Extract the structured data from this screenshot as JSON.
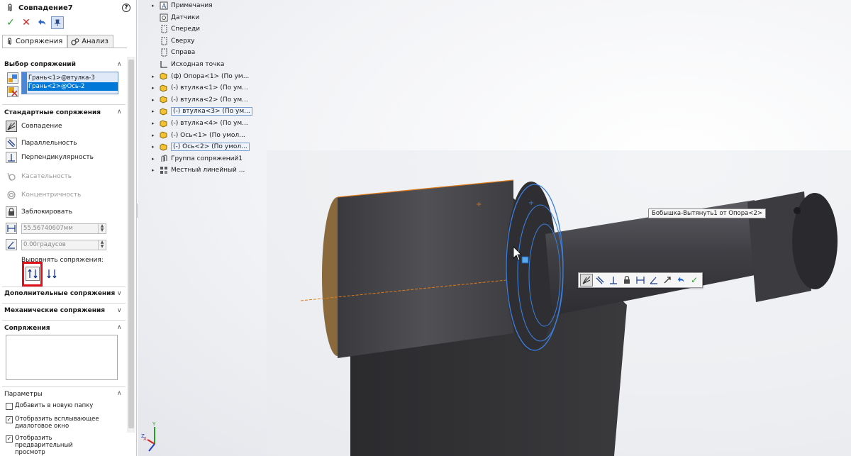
{
  "property_manager": {
    "title": "Совпадение7",
    "tabs": [
      {
        "label": "Сопряжения",
        "active": true
      },
      {
        "label": "Анализ",
        "active": false
      }
    ],
    "mate_selections": {
      "header": "Выбор сопряжений",
      "items": [
        "Грань<1>@втулка-3",
        "Грань<2>@Ось-2"
      ]
    },
    "standard_mates": {
      "header": "Стандартные сопряжения",
      "items": [
        {
          "label": "Совпадение",
          "state": "selected"
        },
        {
          "label": "Параллельность",
          "state": "enabled"
        },
        {
          "label": "Перпендикулярность",
          "state": "enabled"
        },
        {
          "label": "Касательность",
          "state": "disabled"
        },
        {
          "label": "Концентричность",
          "state": "disabled"
        },
        {
          "label": "Заблокировать",
          "state": "enabled"
        }
      ],
      "distance_value": "55.56740607мм",
      "angle_value": "0.00градусов",
      "align_label": "Выровнять сопряжения:"
    },
    "advanced_mates_header": "Дополнительные сопряжения",
    "mechanical_mates_header": "Механические сопряжения",
    "mates_header": "Сопряжения",
    "options": {
      "header": "Параметры",
      "items": [
        {
          "label": "Добавить в новую папку",
          "checked": false
        },
        {
          "label": "Отобразить всплывающее диалоговое окно",
          "checked": true
        },
        {
          "label": "Отобразить предварительный просмотр",
          "checked": true
        }
      ]
    }
  },
  "feature_tree": [
    {
      "label": "Примечания",
      "expandable": true,
      "icon": "annotations-icon",
      "highlight": false
    },
    {
      "label": "Датчики",
      "expandable": false,
      "icon": "sensors-icon",
      "highlight": false
    },
    {
      "label": "Спереди",
      "expandable": false,
      "icon": "plane-icon",
      "highlight": false
    },
    {
      "label": "Сверху",
      "expandable": false,
      "icon": "plane-icon",
      "highlight": false
    },
    {
      "label": "Справа",
      "expandable": false,
      "icon": "plane-icon",
      "highlight": false
    },
    {
      "label": "Исходная точка",
      "expandable": false,
      "icon": "origin-icon",
      "highlight": false
    },
    {
      "label": "(ф) Опора<1> (По ум...",
      "expandable": true,
      "icon": "part-icon",
      "highlight": false
    },
    {
      "label": "(-) втулка<1> (По ум...",
      "expandable": true,
      "icon": "part-icon",
      "highlight": false
    },
    {
      "label": "(-) втулка<2> (По ум...",
      "expandable": true,
      "icon": "part-icon",
      "highlight": false
    },
    {
      "label": "(-) втулка<3> (По ум...",
      "expandable": true,
      "icon": "part-icon",
      "highlight": true
    },
    {
      "label": "(-) втулка<4> (По ум...",
      "expandable": true,
      "icon": "part-icon",
      "highlight": false
    },
    {
      "label": "(-) Ось<1> (По умол...",
      "expandable": true,
      "icon": "part-icon",
      "highlight": false
    },
    {
      "label": "(-) Ось<2> (По умол...",
      "expandable": true,
      "icon": "part-icon",
      "highlight": true
    },
    {
      "label": "Группа сопряжений1",
      "expandable": true,
      "icon": "mates-group-icon",
      "highlight": false
    },
    {
      "label": "Местный линейный ...",
      "expandable": true,
      "icon": "pattern-icon",
      "highlight": false
    }
  ],
  "tooltip": "Бобышка-Вытянуть1 от Опора<2>",
  "triad": {
    "x": "X",
    "y": "Y",
    "z": "Z"
  },
  "colors": {
    "selection_blue": "#0078d7",
    "highlight_red": "#e0101a",
    "part_dark": "#4a4a4f",
    "edge_orange": "#e07a1a",
    "face_blue": "#3a7fe0"
  }
}
